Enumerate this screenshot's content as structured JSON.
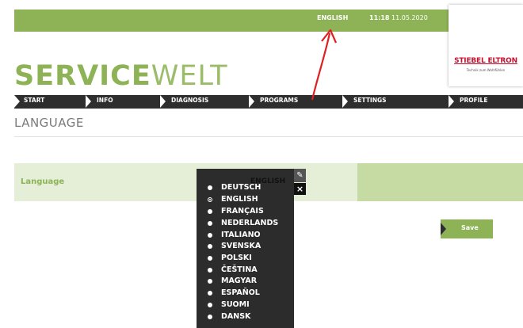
{
  "header": {
    "language_link": "ENGLISH",
    "time": "11:18",
    "date": "11.05.2020"
  },
  "logo": {
    "brand": "STIEBEL ELTRON",
    "tagline": "Technik zum Wohlfühlen"
  },
  "site_title": {
    "bold": "SERVICE",
    "light": "WELT"
  },
  "nav": [
    "START",
    "INFO",
    "DIAGNOSIS",
    "PROGRAMS",
    "SETTINGS",
    "PROFILE"
  ],
  "page_heading": "LANGUAGE",
  "language_row": {
    "label": "Language",
    "current_value": "ENGLISH",
    "options": [
      "DEUTSCH",
      "ENGLISH",
      "FRANÇAIS",
      "NEDERLANDS",
      "ITALIANO",
      "SVENSKA",
      "POLSKI",
      "ČEŠTINA",
      "MAGYAR",
      "ESPAÑOL",
      "SUOMI",
      "DANSK"
    ],
    "selected": "ENGLISH"
  },
  "save_button": "Save",
  "colors": {
    "accent": "#8db356",
    "nav_bg": "#2e2e2e",
    "row_bg": "#e5efd7",
    "row_accent": "#c6dba4",
    "arrow": "#e02020",
    "brand_red": "#c8102e"
  },
  "icons": {
    "edit": "pencil-icon",
    "close": "close-icon"
  }
}
